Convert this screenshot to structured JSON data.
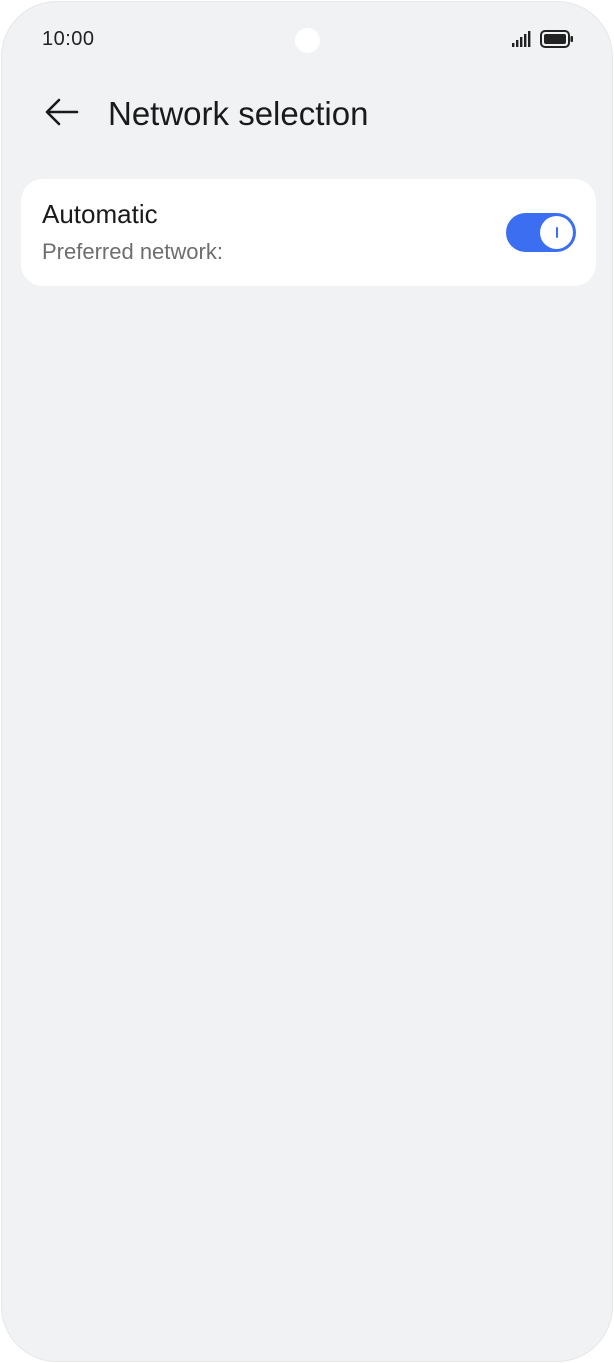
{
  "status_bar": {
    "time": "10:00",
    "icons": [
      "signal-icon",
      "battery-icon"
    ]
  },
  "header": {
    "back_icon": "back-arrow-icon",
    "title": "Network selection"
  },
  "settings": {
    "automatic": {
      "title": "Automatic",
      "subtitle": "Preferred network:",
      "enabled": true
    }
  },
  "colors": {
    "accent": "#3b6ef0",
    "background": "#f1f2f4",
    "card": "#ffffff"
  }
}
